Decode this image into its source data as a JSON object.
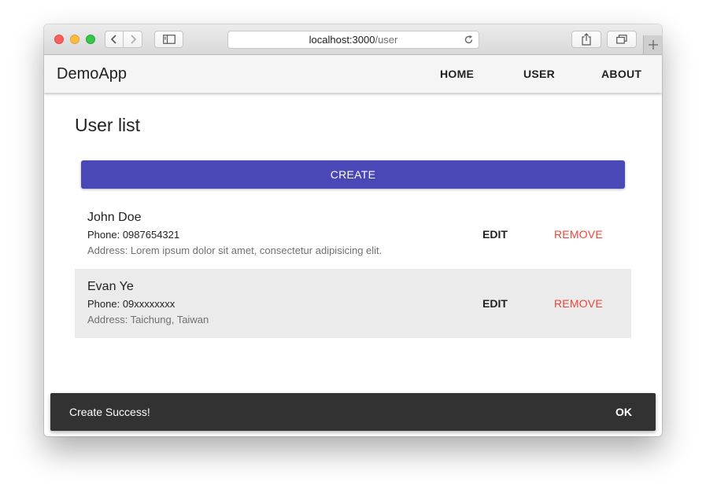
{
  "browser": {
    "url_host": "localhost:3000",
    "url_path": "/user"
  },
  "app": {
    "brand": "DemoApp",
    "nav": [
      "HOME",
      "USER",
      "ABOUT"
    ]
  },
  "page": {
    "title": "User list",
    "create_label": "CREATE"
  },
  "users": [
    {
      "name": "John Doe",
      "phone": "Phone: 0987654321",
      "address": "Address: Lorem ipsum dolor sit amet, consectetur adipisicing elit.",
      "edit_label": "EDIT",
      "remove_label": "REMOVE"
    },
    {
      "name": "Evan Ye",
      "phone": "Phone: 09xxxxxxxx",
      "address": "Address: Taichung, Taiwan",
      "edit_label": "EDIT",
      "remove_label": "REMOVE"
    }
  ],
  "snackbar": {
    "message": "Create Success!",
    "action": "OK"
  },
  "colors": {
    "primary": "#4a47b6",
    "remove": "#f34336",
    "snackbar": "#323232",
    "selected_row": "#ebebeb"
  },
  "icons": [
    "back-icon",
    "forward-icon",
    "sidebar-icon",
    "reload-icon",
    "share-icon",
    "tabs-icon",
    "plus-icon"
  ]
}
